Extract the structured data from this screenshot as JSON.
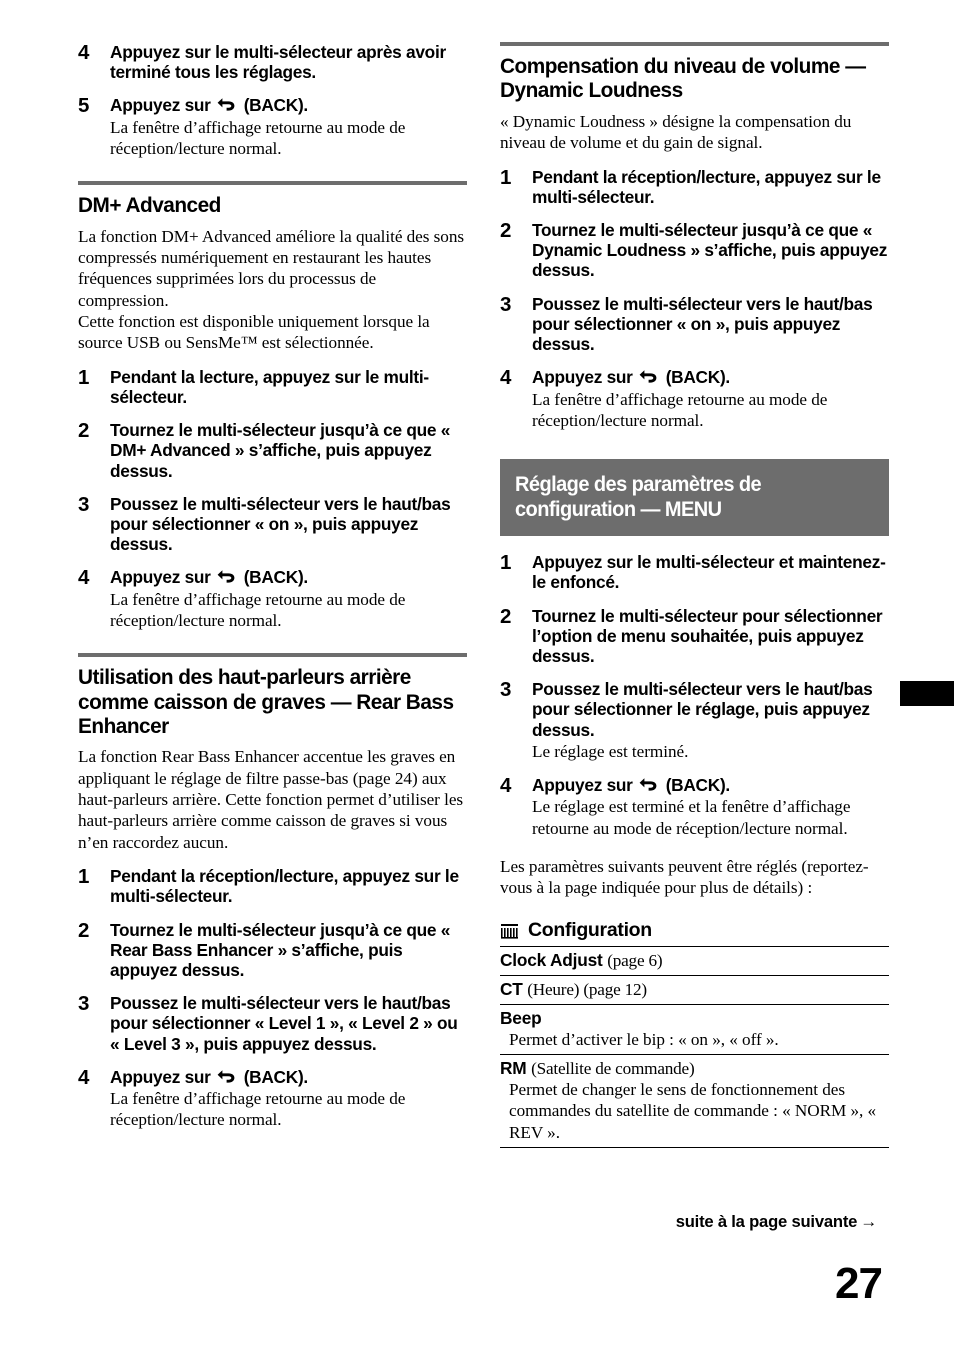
{
  "page": {
    "number": "27",
    "footer_note": "suite à la page suivante",
    "footer_arrow": "→"
  },
  "icons": {
    "back": "back-arrow-icon",
    "configuration": "configuration-grid-icon",
    "edge_tab": "page-edge-tab-marker"
  },
  "left_column": {
    "continued_steps": [
      {
        "num": "4",
        "head": "Appuyez sur le multi-sélecteur après avoir terminé tous les réglages.",
        "body": ""
      },
      {
        "num": "5",
        "head_before": "Appuyez sur",
        "head_after": "(BACK).",
        "body": "La fenêtre d’affichage retourne au mode de réception/lecture normal."
      }
    ],
    "sections": [
      {
        "title": "DM+ Advanced",
        "intro": "La fonction DM+ Advanced améliore la qualité des sons compressés numériquement en restaurant les hautes fréquences supprimées lors du processus de compression.\nCette fonction est disponible uniquement lorsque la source USB ou SensMe™ est sélectionnée.",
        "steps": [
          {
            "num": "1",
            "head": "Pendant la lecture, appuyez sur le multi-sélecteur.",
            "body": ""
          },
          {
            "num": "2",
            "head": "Tournez le multi-sélecteur jusqu’à ce que « DM+ Advanced » s’affiche, puis appuyez dessus.",
            "body": ""
          },
          {
            "num": "3",
            "head": "Poussez le multi-sélecteur vers le haut/bas pour sélectionner « on », puis appuyez dessus.",
            "body": ""
          },
          {
            "num": "4",
            "head_before": "Appuyez sur",
            "head_after": "(BACK).",
            "body": "La fenêtre d’affichage retourne au mode de réception/lecture normal."
          }
        ]
      },
      {
        "title": "Utilisation des haut-parleurs arrière comme caisson de graves — Rear Bass Enhancer",
        "intro": "La fonction Rear Bass Enhancer accentue les graves en appliquant le réglage de filtre passe-bas (page 24) aux haut-parleurs arrière. Cette fonction permet d’utiliser les haut-parleurs arrière comme caisson de graves si vous n’en raccordez aucun.",
        "steps": [
          {
            "num": "1",
            "head": "Pendant la réception/lecture, appuyez sur le multi-sélecteur.",
            "body": ""
          },
          {
            "num": "2",
            "head": "Tournez le multi-sélecteur jusqu’à ce que « Rear Bass Enhancer » s’affiche, puis appuyez dessus.",
            "body": ""
          },
          {
            "num": "3",
            "head": "Poussez le multi-sélecteur vers le haut/bas pour sélectionner « Level 1 », « Level 2 » ou « Level 3 », puis appuyez dessus.",
            "body": ""
          },
          {
            "num": "4",
            "head_before": "Appuyez sur",
            "head_after": "(BACK).",
            "body": "La fenêtre d’affichage retourne au mode de réception/lecture normal."
          }
        ]
      }
    ]
  },
  "right_column": {
    "section": {
      "title": "Compensation du niveau de volume — Dynamic Loudness",
      "intro": "« Dynamic Loudness » désigne la compensation du niveau de volume et du gain de signal.",
      "steps": [
        {
          "num": "1",
          "head": "Pendant la réception/lecture, appuyez sur le multi-sélecteur.",
          "body": ""
        },
        {
          "num": "2",
          "head": "Tournez le multi-sélecteur jusqu’à ce que « Dynamic Loudness » s’affiche, puis appuyez dessus.",
          "body": ""
        },
        {
          "num": "3",
          "head": "Poussez le multi-sélecteur vers le haut/bas pour sélectionner « on », puis appuyez dessus.",
          "body": ""
        },
        {
          "num": "4",
          "head_before": "Appuyez sur",
          "head_after": "(BACK).",
          "body": "La fenêtre d’affichage retourne au mode de réception/lecture normal."
        }
      ]
    },
    "banner": {
      "line1": "Réglage des paramètres de",
      "line2": "configuration — MENU"
    },
    "menu_steps": [
      {
        "num": "1",
        "head": "Appuyez sur le multi-sélecteur et maintenez-le enfoncé.",
        "body": ""
      },
      {
        "num": "2",
        "head": "Tournez le multi-sélecteur pour sélectionner l’option de menu souhaitée, puis appuyez dessus.",
        "body": ""
      },
      {
        "num": "3",
        "head": "Poussez le multi-sélecteur vers le haut/bas pour sélectionner le réglage, puis appuyez dessus.",
        "body": "Le réglage est terminé."
      },
      {
        "num": "4",
        "head_before": "Appuyez sur",
        "head_after": "(BACK).",
        "body": "Le réglage est terminé et la fenêtre d’affichage retourne au mode de réception/lecture normal."
      }
    ],
    "params_intro": "Les paramètres suivants peuvent être réglés (reportez-vous à la page indiquée pour plus de détails) :",
    "config": {
      "heading": "Configuration",
      "rows": [
        {
          "title_bold": "Clock Adjust",
          "title_rest": "(page 6)",
          "desc": ""
        },
        {
          "title_bold": "CT",
          "title_rest": "(Heure) (page 12)",
          "desc": ""
        },
        {
          "title_bold": "Beep",
          "title_rest": "",
          "desc": "Permet d’activer le bip : « on », « off »."
        },
        {
          "title_bold": "RM",
          "title_rest": "(Satellite de commande)",
          "desc": "Permet de changer le sens de fonctionnement des commandes du satellite de commande : « NORM », « REV »."
        }
      ]
    }
  },
  "colors": {
    "rule_gray": "#6d6d6d",
    "banner_gray": "#6d6d6d",
    "text_black": "#000000",
    "banner_text": "#ffffff"
  }
}
